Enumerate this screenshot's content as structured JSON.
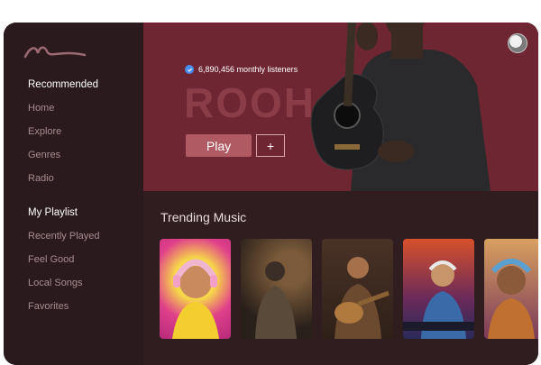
{
  "sidebar": {
    "recommended_title": "Recommended",
    "recommended_items": [
      "Home",
      "Explore",
      "Genres",
      "Radio"
    ],
    "playlist_title": "My Playlist",
    "playlist_items": [
      "Recently Played",
      "Feel Good",
      "Local Songs",
      "Favorites"
    ]
  },
  "hero": {
    "listeners": "6,890,456 monthly listeners",
    "artist": "ROOH",
    "play_label": "Play",
    "add_label": "+"
  },
  "trending": {
    "title": "Trending Music",
    "cards": [
      "card-1",
      "card-2",
      "card-3",
      "card-4",
      "card-5"
    ]
  },
  "colors": {
    "accent": "#b05a63",
    "hero_bg": "#6e2632",
    "app_bg": "#2b1b1e"
  }
}
